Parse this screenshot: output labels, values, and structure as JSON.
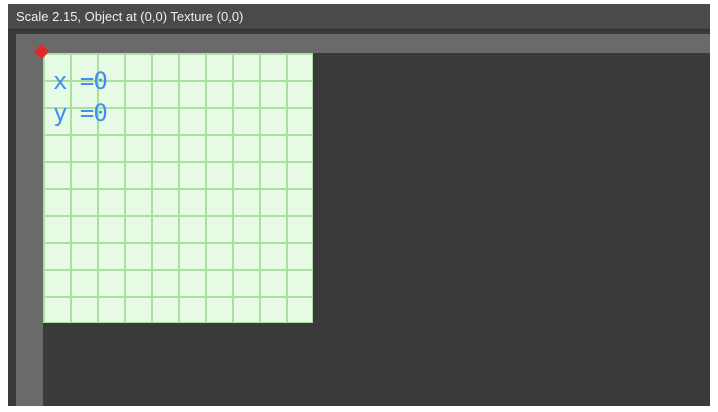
{
  "window": {
    "title": "Scale 2.15, Object at (0,0) Texture (0,0)"
  },
  "overlay": {
    "x_label": "x =0",
    "y_label": "y =0"
  },
  "colors": {
    "background": "#3a3a3a",
    "title_bar": "#4a4a4a",
    "ruler": "#6a6a6a",
    "grid_fill": "#e7fbe4",
    "grid_lines": "#a9e0a0",
    "coordinate_text": "#3f8df5",
    "origin_marker": "#e02a2a"
  },
  "icons": {
    "origin_marker": "red-diamond-icon"
  }
}
